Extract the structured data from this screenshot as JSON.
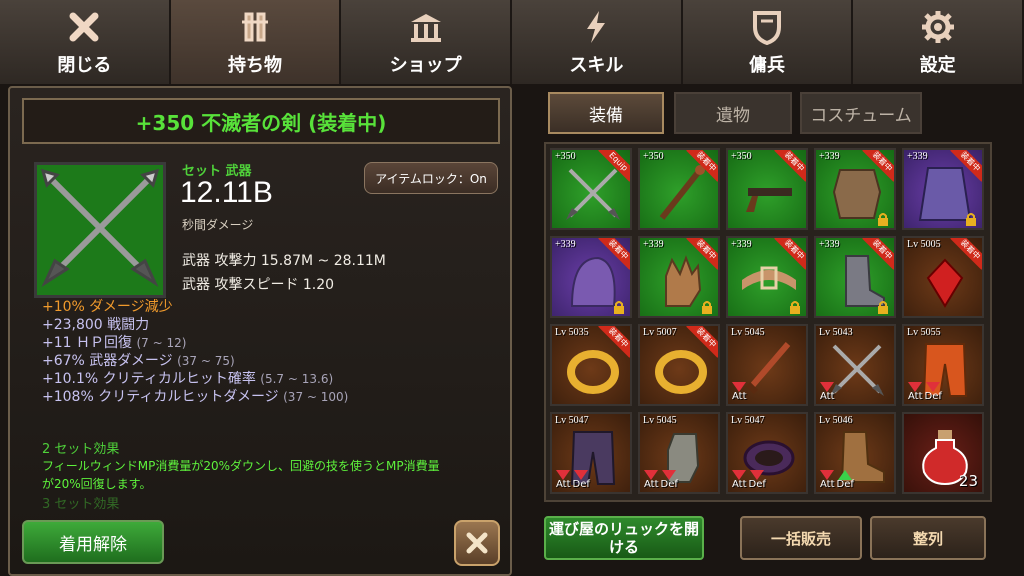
{
  "nav": {
    "tabs": [
      {
        "label": "閉じる",
        "icon": "close-icon"
      },
      {
        "label": "持ち物",
        "icon": "inventory-icon"
      },
      {
        "label": "ショップ",
        "icon": "shop-icon"
      },
      {
        "label": "スキル",
        "icon": "skill-icon"
      },
      {
        "label": "傭兵",
        "icon": "mercenary-icon"
      },
      {
        "label": "設定",
        "icon": "gear-icon"
      }
    ],
    "active": "持ち物"
  },
  "item": {
    "title": "+350 不滅者の剣 (装着中)",
    "set_label": "セット 武器",
    "dps": "12.11B",
    "dps_label": "秒間ダメージ",
    "lock_button": "アイテムロック：On",
    "attack_power": "武器 攻撃力 15.87M ~ 28.11M",
    "attack_speed": "武器 攻撃スピード 1.20",
    "stats": [
      {
        "text": "+10% ダメージ減少",
        "range": "",
        "highlight": true
      },
      {
        "text": "+23,800 戦闘力",
        "range": "",
        "highlight": false
      },
      {
        "text": "+11 ＨＰ回復",
        "range": "(7 ~ 12)",
        "highlight": false
      },
      {
        "text": "+67% 武器ダメージ",
        "range": "(37 ~ 75)",
        "highlight": false
      },
      {
        "text": "+10.1% クリティカルヒット確率",
        "range": "(5.7 ~ 13.6)",
        "highlight": false
      },
      {
        "text": "+108% クリティカルヒットダメージ",
        "range": "(37 ~ 100)",
        "highlight": false
      }
    ],
    "set_effect_header": "2 セット効果",
    "set_effect_desc_1": "フィールウィンドMP消費量が20%ダウンし、回避の技を使うとMP消費量",
    "set_effect_desc_2": "が20%回復します。",
    "set_effect_header_3": "3 セット効果",
    "unequip_button": "着用解除"
  },
  "inventory": {
    "tabs": [
      "装備",
      "遺物",
      "コスチューム"
    ],
    "active_tab": "装備",
    "cells": [
      {
        "level": "+350",
        "badge": "Equip",
        "color": "green",
        "art": "crossed-swords",
        "lock": false
      },
      {
        "level": "+350",
        "badge": "装着中",
        "color": "green",
        "art": "staff",
        "lock": false
      },
      {
        "level": "+350",
        "badge": "装着中",
        "color": "green",
        "art": "pistol",
        "lock": false
      },
      {
        "level": "+339",
        "badge": "装着中",
        "color": "green",
        "art": "armor",
        "lock": true
      },
      {
        "level": "+339",
        "badge": "装着中",
        "color": "purple",
        "art": "cloak",
        "lock": true
      },
      {
        "level": "+339",
        "badge": "装着中",
        "color": "purple",
        "art": "hood",
        "lock": true
      },
      {
        "level": "+339",
        "badge": "装着中",
        "color": "green",
        "art": "glove",
        "lock": true
      },
      {
        "level": "+339",
        "badge": "装着中",
        "color": "green",
        "art": "belt",
        "lock": true
      },
      {
        "level": "+339",
        "badge": "装着中",
        "color": "green",
        "art": "boots",
        "lock": true
      },
      {
        "level": "Lv 5005",
        "badge": "装着中",
        "color": "orange",
        "art": "gem",
        "lock": false
      },
      {
        "level": "Lv 5035",
        "badge": "装着中",
        "color": "orange",
        "art": "ring",
        "lock": false
      },
      {
        "level": "Lv 5007",
        "badge": "装着中",
        "color": "orange",
        "art": "ring",
        "lock": false
      },
      {
        "level": "Lv 5045",
        "badge": "",
        "color": "orange",
        "art": "blade",
        "tags": [
          {
            "t": "Att",
            "up": false
          }
        ]
      },
      {
        "level": "Lv 5043",
        "badge": "",
        "color": "orange",
        "art": "crossed-swords",
        "tags": [
          {
            "t": "Att",
            "up": false
          }
        ]
      },
      {
        "level": "Lv 5055",
        "badge": "",
        "color": "orange",
        "art": "pants",
        "tags": [
          {
            "t": "Att",
            "up": false
          },
          {
            "t": "Def",
            "up": false
          }
        ]
      },
      {
        "level": "Lv 5047",
        "badge": "",
        "color": "orange",
        "art": "pants-dark",
        "tags": [
          {
            "t": "Att",
            "up": false
          },
          {
            "t": "Def",
            "up": false
          }
        ]
      },
      {
        "level": "Lv 5045",
        "badge": "",
        "color": "orange",
        "art": "gauntlet",
        "tags": [
          {
            "t": "Att",
            "up": false
          },
          {
            "t": "Def",
            "up": false
          }
        ]
      },
      {
        "level": "Lv 5047",
        "badge": "",
        "color": "orange",
        "art": "bracelet",
        "tags": [
          {
            "t": "Att",
            "up": false
          },
          {
            "t": "Def",
            "up": false
          }
        ]
      },
      {
        "level": "Lv 5046",
        "badge": "",
        "color": "orange",
        "art": "boot",
        "tags": [
          {
            "t": "Att",
            "up": false
          },
          {
            "t": "Def",
            "up": true
          }
        ]
      },
      {
        "level": "",
        "badge": "",
        "color": "red",
        "art": "potion",
        "qty": "23"
      }
    ],
    "buttons": {
      "porter_line1": "運び屋のリュックを開",
      "porter_line2": "ける",
      "sell_all": "一括販売",
      "sort": "整列"
    }
  }
}
